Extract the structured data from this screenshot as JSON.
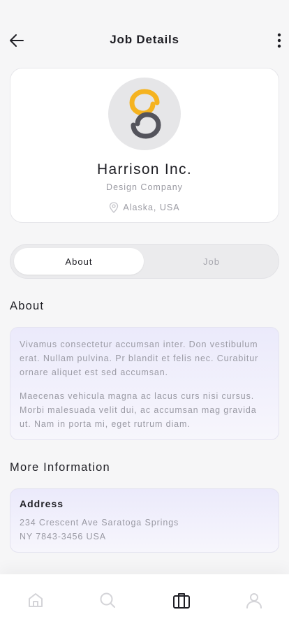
{
  "header": {
    "title": "Job Details",
    "back_icon": "arrow-left-icon",
    "more_icon": "more-vertical-icon"
  },
  "company": {
    "name": "Harrison Inc.",
    "type": "Design Company",
    "location": "Alaska, USA",
    "logo_icon": "swirl-logo",
    "location_icon": "map-pin-icon"
  },
  "tabs": [
    {
      "label": "About",
      "active": true
    },
    {
      "label": "Job",
      "active": false
    }
  ],
  "about": {
    "title": "About",
    "paragraphs": [
      "Vivamus consectetur accumsan inter. Don vestibulum erat. Nullam pulvina. Pr blandit et felis nec. Curabitur ornare aliquet est sed accumsan.",
      "Maecenas vehicula magna ac lacus curs nisi cursus. Morbi malesuada velit dui, ac accumsan mag gravida ut. Nam in porta mi, eget rutrum diam."
    ]
  },
  "more_info": {
    "title": "More Information",
    "address_label": "Address",
    "address_line1": "234 Crescent Ave Saratoga Springs",
    "address_line2": "NY 7843-3456 USA"
  },
  "bottom_nav": [
    {
      "icon": "home-icon",
      "active": false
    },
    {
      "icon": "search-icon",
      "active": false
    },
    {
      "icon": "briefcase-icon",
      "active": true
    },
    {
      "icon": "user-icon",
      "active": false
    }
  ],
  "colors": {
    "accent": "#f5b320",
    "logo_dark": "#54545c",
    "text_primary": "#1e1e24",
    "text_muted": "#9a9aa2",
    "nav_inactive": "#d4d4d8",
    "info_bg": "#ebeafb"
  }
}
